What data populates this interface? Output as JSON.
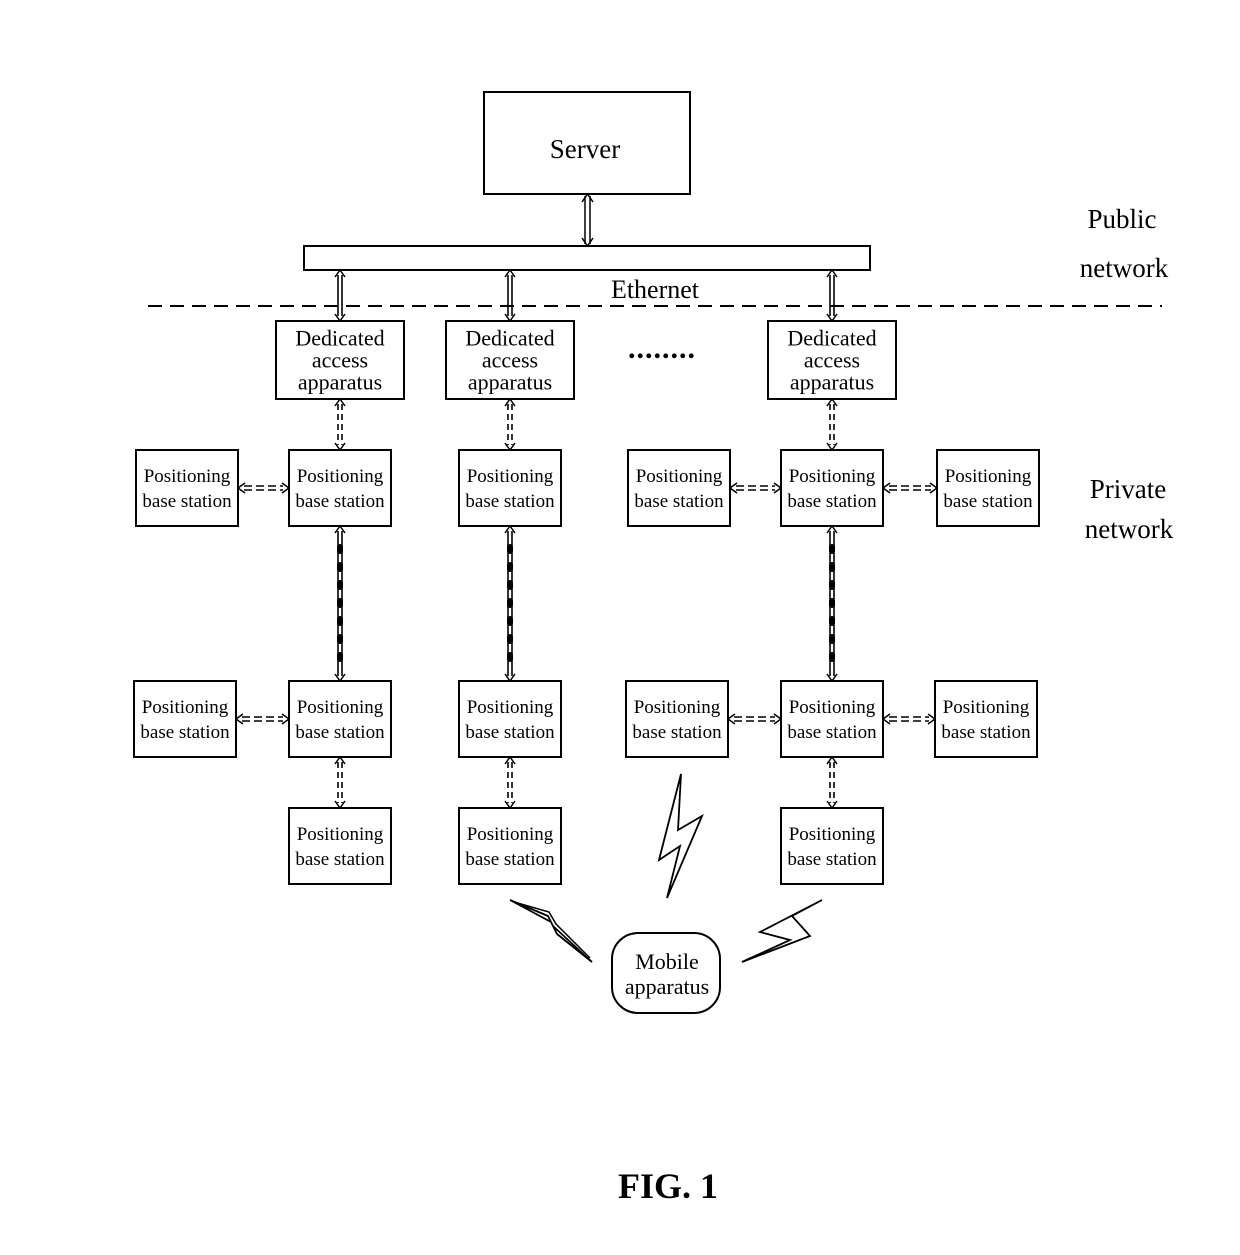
{
  "figure": {
    "caption": "FIG. 1",
    "server_label": "Server",
    "ethernet_label": "Ethernet",
    "public_network_label": [
      "Public",
      "network"
    ],
    "private_network_label": [
      "Private",
      "network"
    ],
    "ellipsis": "........",
    "dedicated_access_label": [
      "Dedicated",
      "access",
      "apparatus"
    ],
    "positioning_label": [
      "Positioning",
      "base station"
    ],
    "mobile_label": [
      "Mobile",
      "apparatus"
    ],
    "access_units": 3,
    "columns": [
      {
        "id": "col-1",
        "top_row_side": "left",
        "mid_row_side": "left",
        "bottom": true
      },
      {
        "id": "col-2",
        "top_row_side": "none",
        "mid_row_side": "none",
        "bottom": true
      },
      {
        "id": "col-3",
        "top_row_side": "both",
        "mid_row_side": "both",
        "bottom": true
      }
    ]
  }
}
